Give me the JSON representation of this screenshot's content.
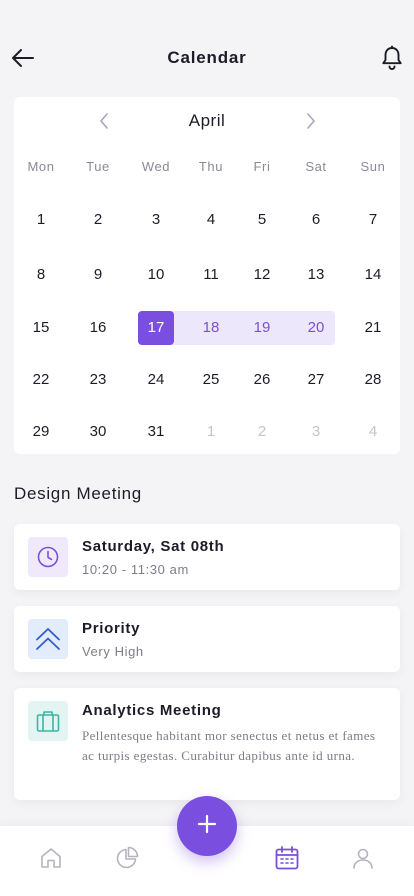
{
  "header": {
    "title": "Calendar"
  },
  "calendar": {
    "month": "April",
    "weekdays": [
      "Mon",
      "Tue",
      "Wed",
      "Thu",
      "Fri",
      "Sat",
      "Sun"
    ],
    "weeks": [
      [
        "1",
        "2",
        "3",
        "4",
        "5",
        "6",
        "7"
      ],
      [
        "8",
        "9",
        "10",
        "11",
        "12",
        "13",
        "14"
      ],
      [
        "15",
        "16",
        "17",
        "18",
        "19",
        "20",
        "21"
      ],
      [
        "22",
        "23",
        "24",
        "25",
        "26",
        "27",
        "28"
      ],
      [
        "29",
        "30",
        "31",
        "1",
        "2",
        "3",
        "4"
      ]
    ],
    "selected_day": "17",
    "range_days": [
      "18",
      "19",
      "20"
    ],
    "next_month_days": [
      "1",
      "2",
      "3",
      "4"
    ]
  },
  "event": {
    "section_title": "Design Meeting",
    "date_card": {
      "icon": "clock-icon",
      "title": "Saturday, Sat 08th",
      "subtitle": "10:20 - 11:30 am"
    },
    "priority_card": {
      "icon": "double-chevron-up-icon",
      "title": "Priority",
      "subtitle": "Very High"
    },
    "meeting_card": {
      "icon": "briefcase-icon",
      "title": "Analytics Meeting",
      "description": "Pellentesque habitant mor senectus et netus et fames ac turpis egestas. Curabitur dapibus ante id urna."
    }
  },
  "tabbar": {
    "items": [
      {
        "name": "home-icon",
        "active": false
      },
      {
        "name": "pie-chart-icon",
        "active": false
      },
      {
        "name": "calendar-icon",
        "active": true
      },
      {
        "name": "user-icon",
        "active": false
      }
    ],
    "fab_icon": "plus-icon"
  },
  "colors": {
    "accent": "#7a4fe0",
    "range_bg": "#ece7fb",
    "clock_bg": "#efe9fb",
    "priority_bg": "#e3ecfb",
    "briefcase_bg": "#e2f5f2"
  }
}
